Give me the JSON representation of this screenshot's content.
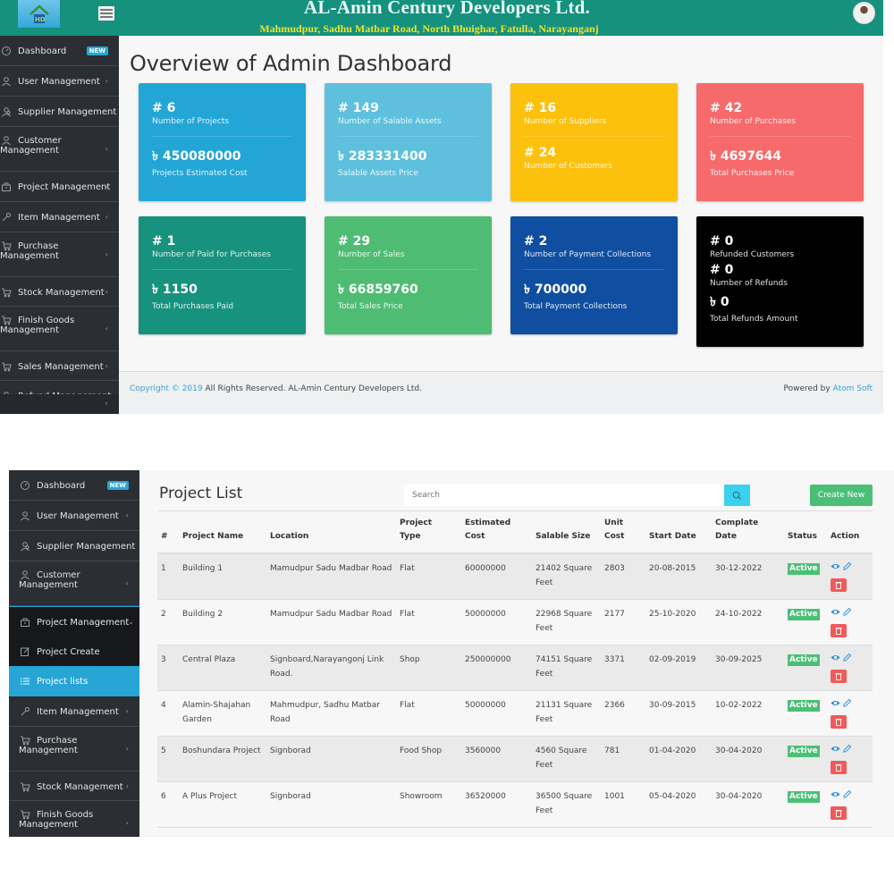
{
  "header": {
    "company": "AL-Amin Century Developers Ltd.",
    "address": "Mahmudpur, Sadhu Matbar Road, North Bhuighar, Fatulla, Narayanganj"
  },
  "colors": {
    "topbar": "#15917e",
    "sidebar": "#2b2e33",
    "accent": "#27a6d6",
    "success": "#4cbf77",
    "danger": "#f05a5a"
  },
  "sidebar1": {
    "items": [
      {
        "label": "Dashboard",
        "badge": "NEW",
        "icon": "dashboard-icon"
      },
      {
        "label": "User Management",
        "icon": "user-icon"
      },
      {
        "label": "Supplier Management",
        "icon": "users-icon"
      },
      {
        "label": "Customer",
        "label2": "Management",
        "icon": "user-icon"
      },
      {
        "label": "Project Management",
        "icon": "briefcase-icon"
      },
      {
        "label": "Item Management",
        "icon": "wrench-icon"
      },
      {
        "label": "Purchase",
        "label2": "Management",
        "icon": "cart-icon"
      },
      {
        "label": "Stock Management",
        "icon": "cart-icon"
      },
      {
        "label": "Finish Goods",
        "label2": "Management",
        "icon": "cart-icon"
      },
      {
        "label": "Sales Management",
        "icon": "cart-icon"
      },
      {
        "label": "Refund Management",
        "icon": "user-icon"
      }
    ]
  },
  "dashboard": {
    "title": "Overview of Admin Dashboard",
    "cards": [
      {
        "n1": "# 6",
        "l1": "Number of Projects",
        "n2": "৳ 450080000",
        "l2": "Projects Estimated Cost",
        "color": "#23a6d5"
      },
      {
        "n1": "# 149",
        "l1": "Number of Salable Assets",
        "n2": "৳ 283331400",
        "l2": "Salable Assets Price",
        "color": "#5fc0dd"
      },
      {
        "n1": "# 16",
        "l1": "Number of Suppliers",
        "n2": "# 24",
        "l2": "Number of Customers",
        "color": "#fcc10d"
      },
      {
        "n1": "# 42",
        "l1": "Number of Purchases",
        "n2": "৳ 4697644",
        "l2": "Total Purchases Price",
        "color": "#f76a6c"
      },
      {
        "n1": "# 1",
        "l1": "Number of Paid for Purchases",
        "n2": "৳ 1150",
        "l2": "Total Purchases Paid",
        "color": "#16927f"
      },
      {
        "n1": "# 29",
        "l1": "Number of Sales",
        "n2": "৳ 66859760",
        "l2": "Total Sales Price",
        "color": "#4fbc74"
      },
      {
        "n1": "# 2",
        "l1": "Number of Payment Collections",
        "n2": "৳ 700000",
        "l2": "Total Payment Collections",
        "color": "#0f4ea1"
      },
      {
        "n1": "# 0",
        "l1": "Refunded Customers",
        "n2": "# 0",
        "l2": "Number of Refunds",
        "n3": "৳ 0",
        "l3": "Total Refunds Amount",
        "color": "#000000"
      }
    ]
  },
  "footer": {
    "copyright_link": "Copyright © 2019",
    "copyright_rest": " All Rights Reserved. AL-Amin Century Developers Ltd.",
    "powered_prefix": "Powered by ",
    "powered_link": "Atom Soft"
  },
  "sidebar2": {
    "items": [
      {
        "label": "Dashboard",
        "badge": "NEW"
      },
      {
        "label": "User Management"
      },
      {
        "label": "Supplier Management"
      },
      {
        "label": "Customer",
        "label2": "Management"
      },
      {
        "label": "Project Management"
      },
      {
        "label": "Project Create"
      },
      {
        "label": "Project lists"
      },
      {
        "label": "Item Management"
      },
      {
        "label": "Purchase",
        "label2": "Management"
      },
      {
        "label": "Stock Management"
      },
      {
        "label": "Finish Goods",
        "label2": "Management"
      }
    ]
  },
  "project_list": {
    "title": "Project List",
    "search_placeholder": "Search",
    "create_label": "Create New",
    "columns": [
      {
        "l1": "#",
        "l2": ""
      },
      {
        "l1": "",
        "l2": "Project Name"
      },
      {
        "l1": "",
        "l2": "Location"
      },
      {
        "l1": "Project",
        "l2": "Type"
      },
      {
        "l1": "Estimated",
        "l2": "Cost"
      },
      {
        "l1": "",
        "l2": "Salable Size"
      },
      {
        "l1": "Unit",
        "l2": "Cost"
      },
      {
        "l1": "",
        "l2": "Start Date"
      },
      {
        "l1": "Complate",
        "l2": "Date"
      },
      {
        "l1": "",
        "l2": "Status"
      },
      {
        "l1": "",
        "l2": "Action"
      }
    ],
    "rows": [
      {
        "no": "1",
        "name": "Building 1",
        "location": "Mamudpur Sadu Madbar Road",
        "type": "Flat",
        "cost": "60000000",
        "size": "21402 Square Feet",
        "unit": "2803",
        "start": "20-08-2015",
        "end": "30-12-2022",
        "status": "Active"
      },
      {
        "no": "2",
        "name": "Building 2",
        "location": "Mamudpur Sadu Madbar Road",
        "type": "Flat",
        "cost": "50000000",
        "size": "22968 Square Feet",
        "unit": "2177",
        "start": "25-10-2020",
        "end": "24-10-2022",
        "status": "Active"
      },
      {
        "no": "3",
        "name": "Central Plaza",
        "location": "Signboard,Narayangonj Link Road.",
        "type": "Shop",
        "cost": "250000000",
        "size": "74151 Square Feet",
        "unit": "3371",
        "start": "02-09-2019",
        "end": "30-09-2025",
        "status": "Active"
      },
      {
        "no": "4",
        "name": "Alamin-Shajahan Garden",
        "location": "Mahmudpur, Sadhu Matbar Road",
        "type": "Flat",
        "cost": "50000000",
        "size": "21131 Square Feet",
        "unit": "2366",
        "start": "30-09-2015",
        "end": "10-02-2022",
        "status": "Active"
      },
      {
        "no": "5",
        "name": "Boshundara Project",
        "location": "Signborad",
        "type": "Food Shop",
        "cost": "3560000",
        "size": "4560 Square Feet",
        "unit": "781",
        "start": "01-04-2020",
        "end": "30-04-2020",
        "status": "Active"
      },
      {
        "no": "6",
        "name": "A Plus Project",
        "location": "Signborad",
        "type": "Showroom",
        "cost": "36520000",
        "size": "36500 Square Feet",
        "unit": "1001",
        "start": "05-04-2020",
        "end": "30-04-2020",
        "status": "Active"
      }
    ]
  }
}
